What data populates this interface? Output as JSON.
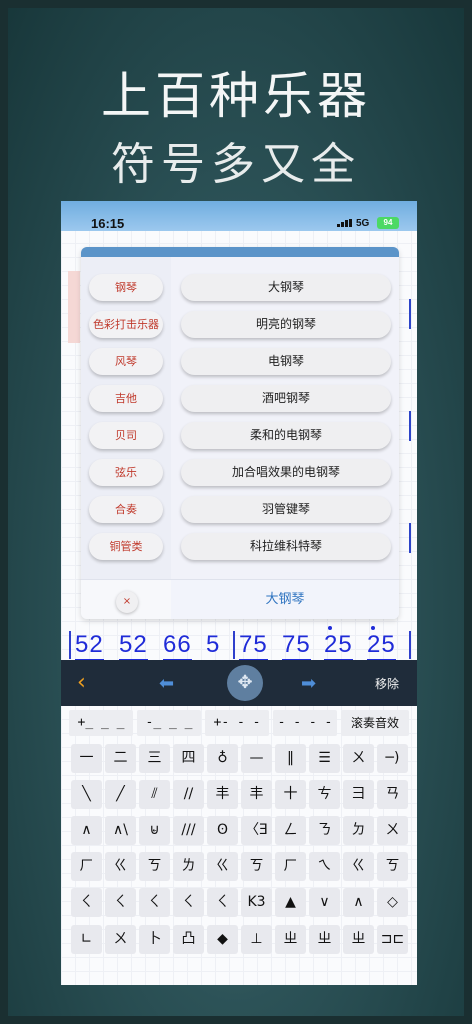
{
  "hero": {
    "line1": "上百种乐器",
    "line2": "符号多又全"
  },
  "status": {
    "time": "16:15",
    "network": "5G",
    "battery": "94"
  },
  "picker": {
    "categories": [
      "钢琴",
      "色彩打击乐器",
      "风琴",
      "吉他",
      "贝司",
      "弦乐",
      "合奏",
      "铜管类"
    ],
    "instruments": [
      "大钢琴",
      "明亮的钢琴",
      "电钢琴",
      "酒吧钢琴",
      "柔和的电钢琴",
      "加合唱效果的电钢琴",
      "羽管键琴",
      "科拉维科特琴"
    ],
    "close_label": "×",
    "selected": "大钢琴"
  },
  "score": {
    "notes": [
      "52",
      "52",
      "66",
      "5",
      "75",
      "75",
      "25",
      "25"
    ]
  },
  "toolbar": {
    "back_icon": "‹",
    "left_icon": "⬅",
    "move_icon": "✥",
    "right_icon": "➡",
    "remove_label": "移除"
  },
  "keyboard": {
    "row1": [
      "+_ _ _",
      "-_ _ _",
      "+- - -",
      "- - - -",
      "滚奏音效"
    ],
    "rows": [
      [
        "一",
        "二",
        "三",
        "四",
        "♁",
        "—",
        "‖",
        "☰",
        "ㄨ",
        "─)"
      ],
      [
        "╲",
        "╱",
        "⫽",
        "//",
        "丰",
        "丰",
        "十",
        "ㄘ",
        "彐",
        "ㄢ"
      ],
      [
        "∧",
        "∧\\",
        "⊌",
        "///",
        "ʘ",
        "〈Ǝ",
        "ㄥ",
        "ㄋ",
        "ㄉ",
        "ㄨ"
      ],
      [
        "ㄏ",
        "ㄍ",
        "ㄎ",
        "ㄌ",
        "ㄍ",
        "ㄎ",
        "ㄏ",
        "ㄟ",
        "ㄍ",
        "ㄎ"
      ],
      [
        "ㄑ",
        "ㄑ",
        "ㄑ",
        "ㄑ",
        "ㄑ",
        "K3",
        "▲",
        "∨",
        "∧",
        "◇"
      ],
      [
        "∟",
        "ㄨ",
        "卜",
        "凸",
        "◆",
        "⊥",
        "ㄓ",
        "ㄓ",
        "ㄓ",
        "⊐⊏"
      ]
    ]
  }
}
